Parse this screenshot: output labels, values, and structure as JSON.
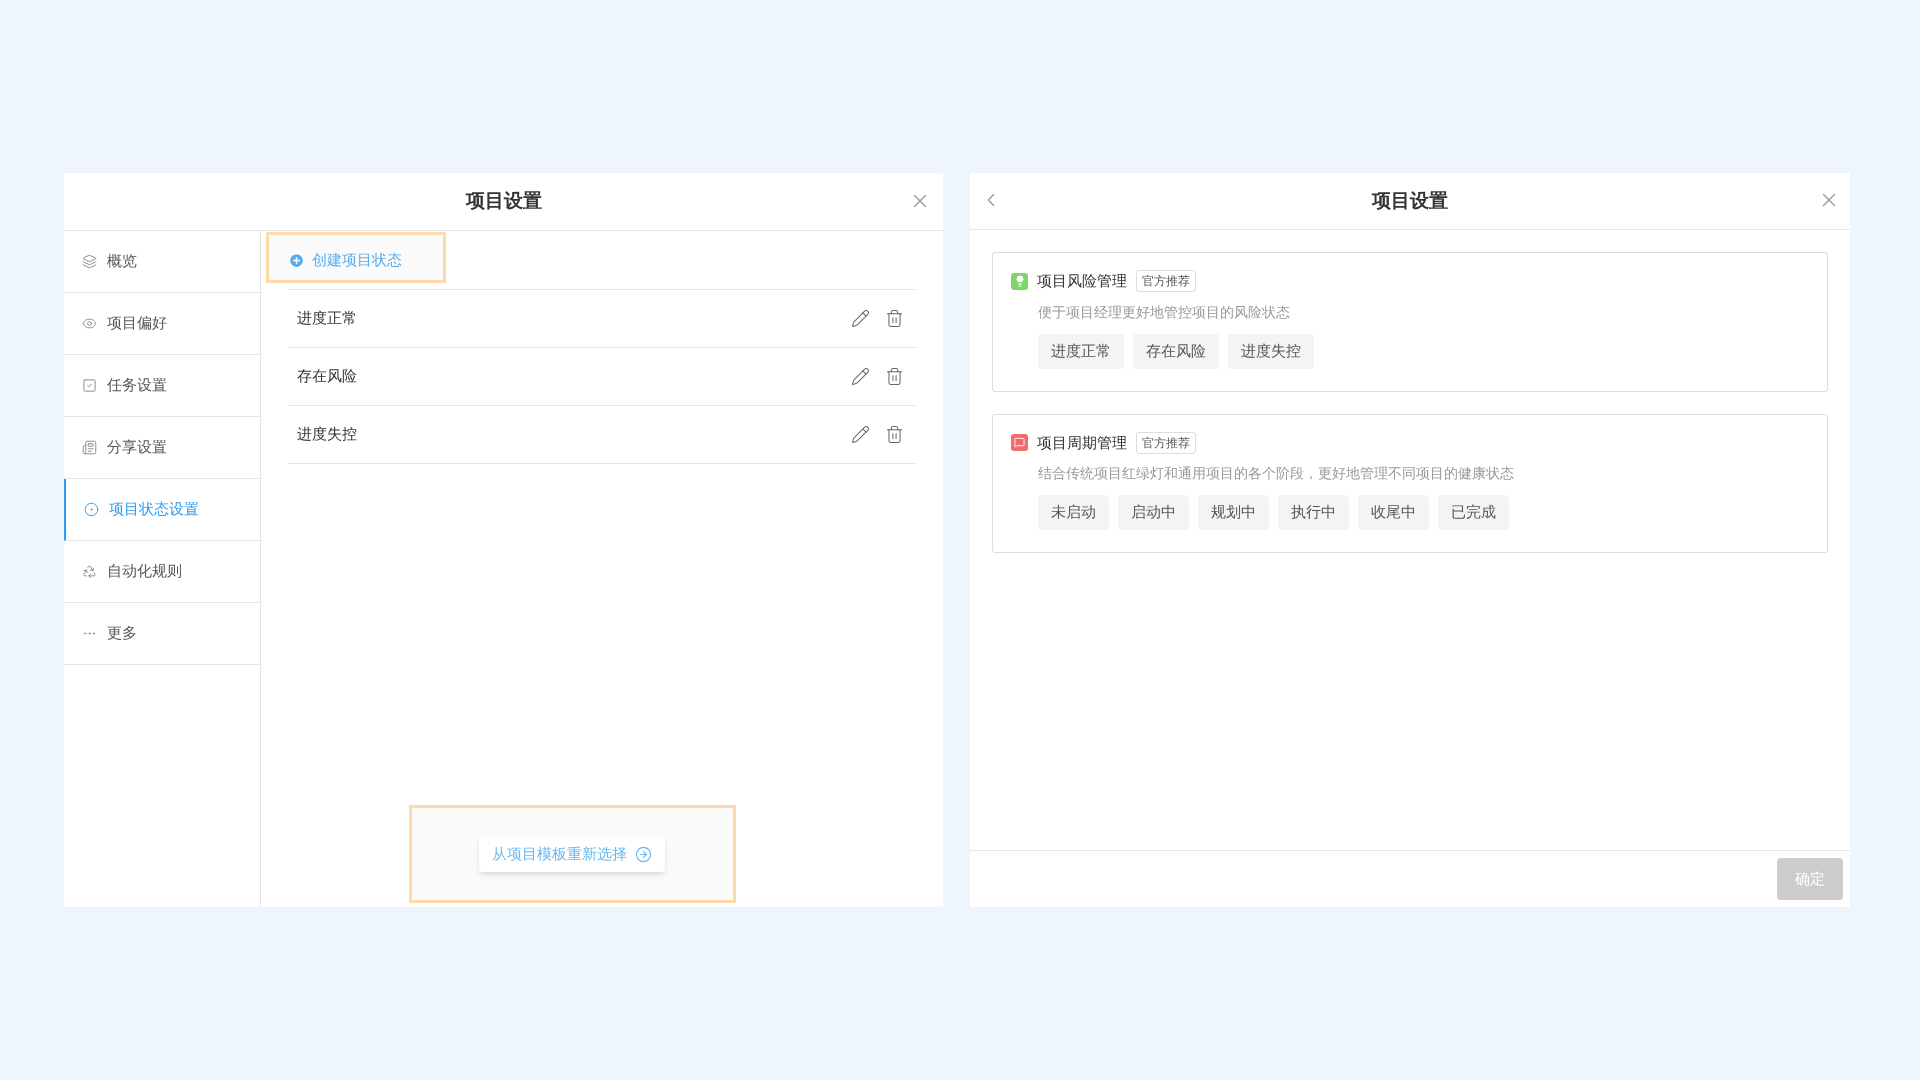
{
  "left_dialog": {
    "title": "项目设置",
    "sidebar": {
      "items": [
        {
          "label": "概览",
          "selected": false
        },
        {
          "label": "项目偏好",
          "selected": false
        },
        {
          "label": "任务设置",
          "selected": false
        },
        {
          "label": "分享设置",
          "selected": false
        },
        {
          "label": "项目状态设置",
          "selected": true
        },
        {
          "label": "自动化规则",
          "selected": false
        },
        {
          "label": "更多",
          "selected": false
        }
      ]
    },
    "create_button": "创建项目状态",
    "statuses": [
      {
        "name": "进度正常"
      },
      {
        "name": "存在风险"
      },
      {
        "name": "进度失控"
      }
    ],
    "template_button": "从项目模板重新选择"
  },
  "right_dialog": {
    "title": "项目设置",
    "templates": [
      {
        "title": "项目风险管理",
        "badge": "官方推荐",
        "color": "#7ed66b",
        "description": "便于项目经理更好地管控项目的风险状态",
        "tags": [
          "进度正常",
          "存在风险",
          "进度失控"
        ]
      },
      {
        "title": "项目周期管理",
        "badge": "官方推荐",
        "color": "#f26b6b",
        "description": "结合传统项目红绿灯和通用项目的各个阶段，更好地管理不同项目的健康状态",
        "tags": [
          "未启动",
          "启动中",
          "规划中",
          "执行中",
          "收尾中",
          "已完成"
        ]
      }
    ],
    "confirm_button": {
      "label": "确定",
      "disabled": true
    }
  }
}
